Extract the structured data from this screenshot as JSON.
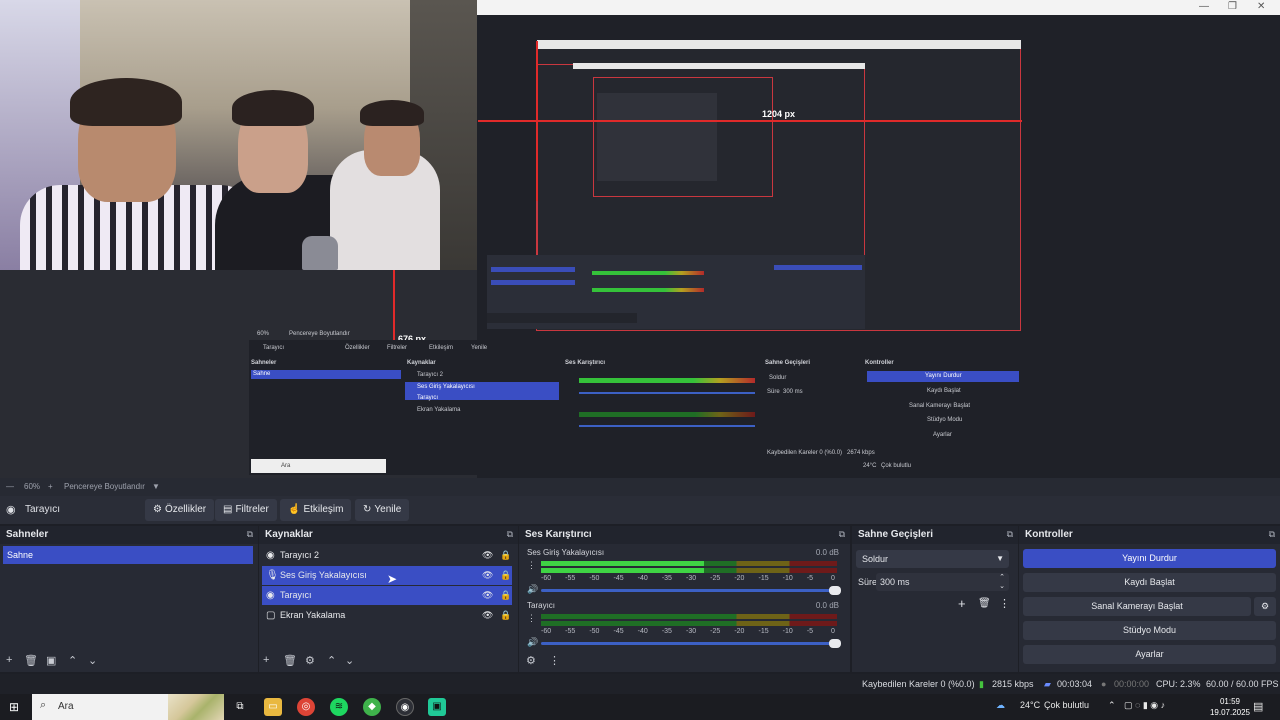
{
  "preview": {
    "window_controls": [
      "—",
      "❐",
      "✕"
    ],
    "measure_width": "1204 px",
    "measure_height": "676 px"
  },
  "mini": {
    "zoom": "60%",
    "fit": "Pencereye Boyutlandır",
    "source": "Tarayıcı",
    "buttons": [
      "Özellikler",
      "Filtreler",
      "Etkileşim",
      "Yenile"
    ],
    "docks": [
      "Sahneler",
      "Kaynaklar",
      "Ses Karıştırıcı",
      "Sahne Geçişleri",
      "Kontroller"
    ],
    "scene": "Sahne",
    "sources": [
      "Tarayıcı 2",
      "Ses Giriş Yakalayıcısı",
      "Tarayıcı",
      "Ekran Yakalama"
    ],
    "controls": [
      "Yayını Durdur",
      "Kaydı Başlat",
      "Sanal Kamerayı Başlat",
      "Stüdyo Modu",
      "Ayarlar"
    ],
    "transition": "Soldur",
    "duration_label": "Süre",
    "duration": "300 ms",
    "status": "Kaybedilen Kareler 0 (%0.0)",
    "bitrate": "2674 kbps",
    "taskbar_search": "Ara",
    "temp": "24°C",
    "weather": "Çok bulutlu"
  },
  "zoomrow": {
    "zoom": "60%",
    "fit": "Pencereye Boyutlandır"
  },
  "context": {
    "source": "Tarayıcı",
    "properties": "Özellikler",
    "filters": "Filtreler",
    "interact": "Etkileşim",
    "refresh": "Yenile"
  },
  "scenes": {
    "title": "Sahneler",
    "items": [
      "Sahne"
    ]
  },
  "sources": {
    "title": "Kaynaklar",
    "items": [
      {
        "label": "Tarayıcı 2",
        "icon": "globe-icon"
      },
      {
        "label": "Ses Giriş Yakalayıcısı",
        "icon": "microphone-icon"
      },
      {
        "label": "Tarayıcı",
        "icon": "globe-icon"
      },
      {
        "label": "Ekran Yakalama",
        "icon": "monitor-icon"
      }
    ]
  },
  "mixer": {
    "title": "Ses Karıştırıcı",
    "ticks": [
      "-60",
      "-55",
      "-50",
      "-45",
      "-40",
      "-35",
      "-30",
      "-25",
      "-20",
      "-15",
      "-10",
      "-5",
      "0"
    ],
    "channels": [
      {
        "name": "Ses Giriş Yakalayıcısı",
        "db": "0.0 dB",
        "level": 0.55
      },
      {
        "name": "Tarayıcı",
        "db": "0.0 dB",
        "level": 0.0
      }
    ]
  },
  "transitions": {
    "title": "Sahne Geçişleri",
    "selected": "Soldur",
    "duration_label": "Süre",
    "duration": "300 ms"
  },
  "controls": {
    "title": "Kontroller",
    "stop_stream": "Yayını Durdur",
    "start_record": "Kaydı Başlat",
    "start_vcam": "Sanal Kamerayı Başlat",
    "studio_mode": "Stüdyo Modu",
    "settings": "Ayarlar"
  },
  "status": {
    "dropped": "Kaybedilen Kareler 0 (%0.0)",
    "bitrate": "2815 kbps",
    "stream_time": "00:03:04",
    "rec_time": "00:00:00",
    "cpu": "CPU: 2.3%",
    "fps": "60.00 / 60.00 FPS"
  },
  "taskbar": {
    "search_placeholder": "Ara",
    "temperature": "24°C",
    "weather": "Çok bulutlu",
    "time": "01:59",
    "date": "19.07.2025"
  },
  "colors": {
    "accent": "#3a4ec4",
    "background": "#1d1f26",
    "panel": "#272a34",
    "meter_green": "#3fd444",
    "meter_yellow": "#b3a020",
    "meter_red": "#b32a2a"
  }
}
